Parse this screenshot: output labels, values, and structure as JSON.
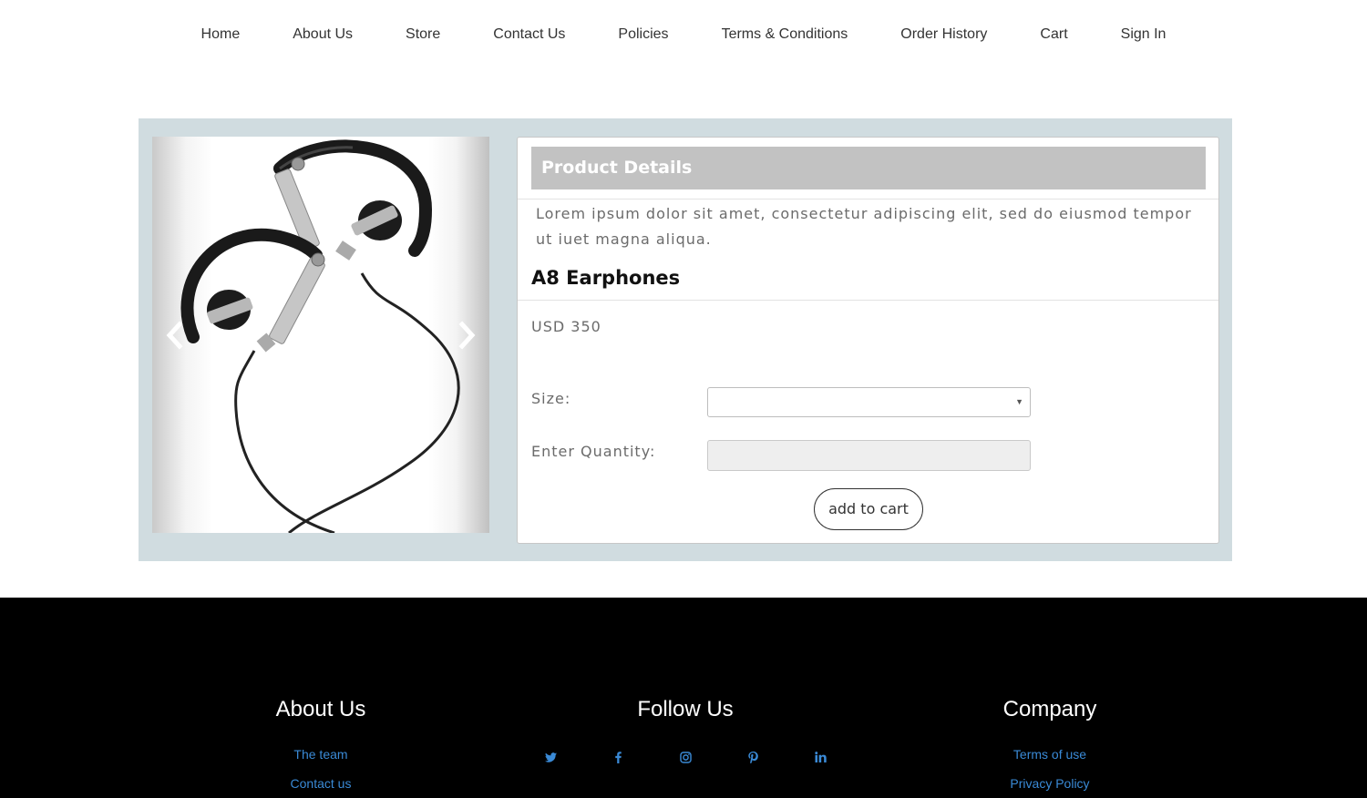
{
  "nav": {
    "items": [
      "Home",
      "About Us",
      "Store",
      "Contact Us",
      "Policies",
      "Terms & Conditions",
      "Order History",
      "Cart",
      "Sign In"
    ]
  },
  "carousel": {
    "prev_icon": "chevron-left-icon",
    "next_icon": "chevron-right-icon",
    "image_icon": "earphones-image"
  },
  "product": {
    "header": "Product Details",
    "description": "Lorem ipsum dolor sit amet, consectetur adipiscing elit, sed do eiusmod tempor ut iuet magna aliqua.",
    "name": "A8 Earphones",
    "price": "USD 350",
    "size_label": "Size:",
    "size_value": "",
    "quantity_label": "Enter Quantity:",
    "quantity_value": "",
    "add_button": "add to cart"
  },
  "footer": {
    "about": {
      "title": "About Us",
      "links": [
        "The team",
        "Contact us"
      ]
    },
    "follow": {
      "title": "Follow Us",
      "icons": [
        "twitter-icon",
        "facebook-icon",
        "instagram-icon",
        "pinterest-icon",
        "linkedin-icon"
      ]
    },
    "company": {
      "title": "Company",
      "links": [
        "Terms of use",
        "Privacy Policy"
      ]
    }
  },
  "colors": {
    "panel_bg": "#d0dce0",
    "header_bg": "#c2c2c2",
    "footer_bg": "#000000",
    "link": "#3a8ad6"
  }
}
